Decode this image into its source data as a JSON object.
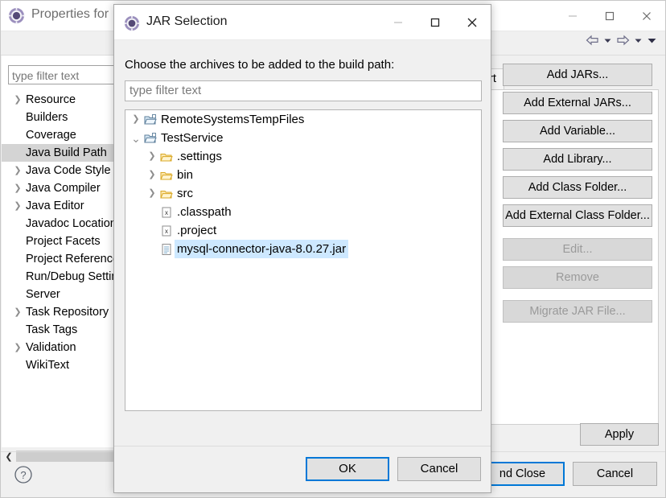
{
  "background_window": {
    "title": "Properties for",
    "icon": "eclipse-icon",
    "window_controls": [
      {
        "name": "minimize-button",
        "glyph": "minimize-icon"
      },
      {
        "name": "maximize-button",
        "glyph": "maximize-icon"
      },
      {
        "name": "close-button",
        "glyph": "close-icon"
      }
    ],
    "toolbar_icons": [
      {
        "name": "back-arrow-icon"
      },
      {
        "name": "back-dropdown-icon"
      },
      {
        "name": "forward-arrow-icon"
      },
      {
        "name": "forward-dropdown-icon"
      },
      {
        "name": "menu-dropdown-icon"
      }
    ],
    "filter": {
      "placeholder": "type filter text",
      "value": "type filter text"
    },
    "tree_items": [
      {
        "label": "Resource",
        "expandable": true,
        "selected": false
      },
      {
        "label": "Builders",
        "expandable": false,
        "selected": false
      },
      {
        "label": "Coverage",
        "expandable": false,
        "selected": false
      },
      {
        "label": "Java Build Path",
        "expandable": false,
        "selected": true
      },
      {
        "label": "Java Code Style",
        "expandable": true,
        "selected": false
      },
      {
        "label": "Java Compiler",
        "expandable": true,
        "selected": false
      },
      {
        "label": "Java Editor",
        "expandable": true,
        "selected": false
      },
      {
        "label": "Javadoc Location",
        "expandable": false,
        "selected": false
      },
      {
        "label": "Project Facets",
        "expandable": false,
        "selected": false
      },
      {
        "label": "Project References",
        "expandable": false,
        "selected": false
      },
      {
        "label": "Run/Debug Settings",
        "expandable": false,
        "selected": false
      },
      {
        "label": "Server",
        "expandable": false,
        "selected": false
      },
      {
        "label": "Task Repository",
        "expandable": true,
        "selected": false
      },
      {
        "label": "Task Tags",
        "expandable": false,
        "selected": false
      },
      {
        "label": "Validation",
        "expandable": true,
        "selected": false
      },
      {
        "label": "WikiText",
        "expandable": false,
        "selected": false
      }
    ],
    "tab_visible_label": "ort",
    "side_buttons": [
      {
        "label": "Add JARs...",
        "enabled": true
      },
      {
        "label": "Add External JARs...",
        "enabled": true
      },
      {
        "label": "Add Variable...",
        "enabled": true
      },
      {
        "label": "Add Library...",
        "enabled": true
      },
      {
        "label": "Add Class Folder...",
        "enabled": true
      },
      {
        "label": "Add External Class Folder...",
        "enabled": true
      },
      {
        "label": "Edit...",
        "enabled": false
      },
      {
        "label": "Remove",
        "enabled": false
      },
      {
        "label": "Migrate JAR File...",
        "enabled": false
      }
    ],
    "apply_label": "Apply",
    "bottom_buttons": [
      {
        "label": "nd Close",
        "default": true
      },
      {
        "label": "Cancel",
        "default": false
      }
    ],
    "help_icon": "help-icon",
    "hscroll_left_arrow": "chevron-left-icon"
  },
  "dialog": {
    "title": "JAR Selection",
    "icon": "eclipse-icon",
    "window_controls": [
      {
        "name": "dialog-minimize-button",
        "glyph": "minimize-icon"
      },
      {
        "name": "dialog-maximize-button",
        "glyph": "maximize-icon"
      },
      {
        "name": "dialog-close-button",
        "glyph": "close-icon"
      }
    ],
    "prompt": "Choose the archives to be added to the build path:",
    "filter": {
      "placeholder": "type filter text",
      "value": "type filter text"
    },
    "tree": [
      {
        "label": "RemoteSystemsTempFiles",
        "depth": 0,
        "twisty": "collapsed",
        "icon": "folder-project-icon",
        "selected": false
      },
      {
        "label": "TestService",
        "depth": 0,
        "twisty": "expanded",
        "icon": "folder-project-open-icon",
        "selected": false
      },
      {
        "label": ".settings",
        "depth": 1,
        "twisty": "collapsed",
        "icon": "folder-icon",
        "selected": false
      },
      {
        "label": "bin",
        "depth": 1,
        "twisty": "collapsed",
        "icon": "folder-icon",
        "selected": false
      },
      {
        "label": "src",
        "depth": 1,
        "twisty": "collapsed",
        "icon": "folder-icon",
        "selected": false
      },
      {
        "label": ".classpath",
        "depth": 1,
        "twisty": "none",
        "icon": "xml-file-icon",
        "selected": false
      },
      {
        "label": ".project",
        "depth": 1,
        "twisty": "none",
        "icon": "xml-file-icon",
        "selected": false
      },
      {
        "label": "mysql-connector-java-8.0.27.jar",
        "depth": 1,
        "twisty": "none",
        "icon": "jar-file-icon",
        "selected": true
      }
    ],
    "buttons": [
      {
        "label": "OK",
        "default": true
      },
      {
        "label": "Cancel",
        "default": false
      }
    ]
  },
  "colors": {
    "accent": "#0078d7",
    "selection_blue": "#cde8ff",
    "selection_gray": "#d4d4d4",
    "window_bg": "#f0f0f0",
    "button_face": "#e1e1e1"
  }
}
